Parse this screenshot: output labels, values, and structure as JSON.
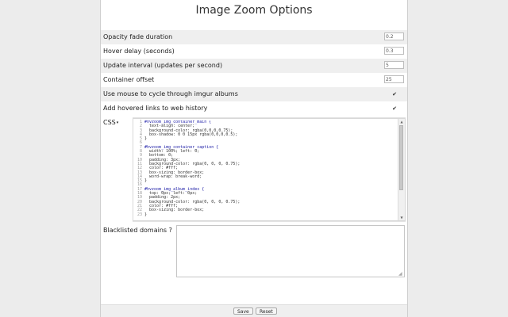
{
  "page": {
    "title": "Image Zoom Options"
  },
  "options": [
    {
      "label": "Opacity fade duration",
      "type": "text",
      "value": "0.2"
    },
    {
      "label": "Hover delay (seconds)",
      "type": "text",
      "value": "0.3"
    },
    {
      "label": "Update interval (updates per second)",
      "type": "text",
      "value": "5"
    },
    {
      "label": "Container offset",
      "type": "text",
      "value": "25"
    },
    {
      "label": "Use mouse to cycle through imgur albums",
      "type": "checkbox",
      "checked": true,
      "mark": "✔"
    },
    {
      "label": "Add hovered links to web history",
      "type": "checkbox",
      "checked": true,
      "mark": "✔"
    }
  ],
  "css_section": {
    "label": "CSS",
    "caret": "▾",
    "line_numbers": [
      "1",
      "2",
      "3",
      "4",
      "5",
      "6",
      "7",
      "8",
      "9",
      "10",
      "11",
      "12",
      "13",
      "14",
      "15",
      "16",
      "17",
      "18",
      "19",
      "20",
      "21",
      "22",
      "23"
    ],
    "code_lines": [
      "#hvzoom_img_container_main {",
      "  text-align: center;",
      "  background-color: rgba(0,0,0,0.75);",
      "  box-shadow: 0 0 15px rgba(0,0,0,0.5);",
      "}",
      "",
      "#hvzoom_img_container_caption {",
      "  width: 100%; left: 0;",
      "  bottom: 0;",
      "  padding: 3px;",
      "  background-color: rgba(0, 0, 0, 0.75);",
      "  color: #fff;",
      "  box-sizing: border-box;",
      "  word-wrap: break-word;",
      "}",
      "",
      "#hvzoom_img_album_index {",
      "  top: 0px; left: 0px;",
      "  padding: 2px;",
      "  background-color: rgba(0, 0, 0, 0.75);",
      "  color: #fff;",
      "  box-sizing: border-box;",
      "}"
    ],
    "scroll_up": "▲",
    "scroll_down": "▼"
  },
  "blacklist": {
    "label": "Blacklisted domains ?",
    "value": "",
    "grip": "◢"
  },
  "footer": {
    "save_label": "Save",
    "reset_label": "Reset"
  }
}
